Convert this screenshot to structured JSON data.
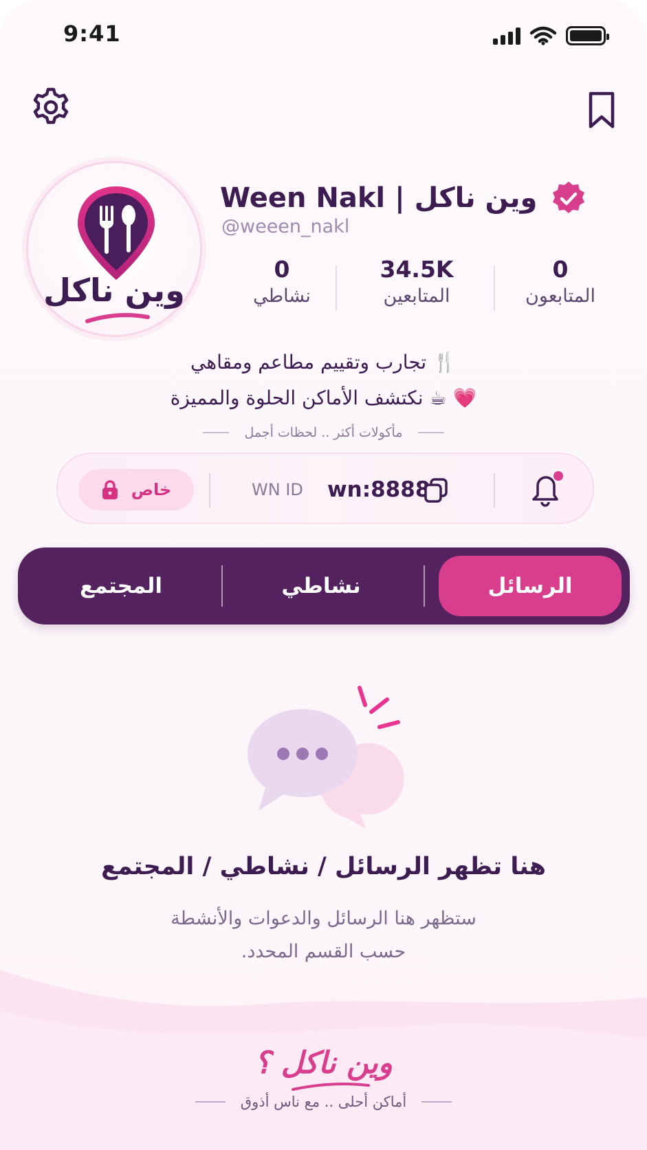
{
  "status_bar": {
    "time": "9:41"
  },
  "profile": {
    "logo_text": "وين ناكل",
    "name": "Ween Nakl | وين ناكل",
    "handle": "@weeen_nakl",
    "stats": [
      {
        "value": "0",
        "label": "نشاطي"
      },
      {
        "value": "34.5K",
        "label": "المتابعين"
      },
      {
        "value": "0",
        "label": "المتابعون"
      }
    ],
    "bio_line1": "🍴 تجارب وتقييم مطاعم ومقاهي",
    "bio_line2": "💗 ☕ نكتشف الأماكن الحلوة والمميزة",
    "tagline": "مأكولات أكثر .. لحظات أجمل"
  },
  "id_card": {
    "privacy_label": "خاص",
    "id_label": "WN ID",
    "id_value": "wn:8888"
  },
  "tabs": [
    {
      "label": "الرسائل",
      "active": true
    },
    {
      "label": "نشاطي",
      "active": false
    },
    {
      "label": "المجتمع",
      "active": false
    }
  ],
  "empty_state": {
    "title": "هنا تظهر الرسائل / نشاطي / المجتمع",
    "desc_line1": "ستظهر هنا الرسائل والدعوات والأنشطة",
    "desc_line2": "حسب القسم المحدد."
  },
  "footer": {
    "logo": "وين ناكل ؟",
    "tagline": "أماكن أحلى .. مع ناس أذوق"
  },
  "colors": {
    "primary_purple": "#54235f",
    "accent_pink": "#d93d8e",
    "text_dark": "#3d1c52"
  },
  "icons": [
    "gear-icon",
    "bookmark-icon",
    "verified-badge-icon",
    "lock-icon",
    "copy-icon",
    "bell-icon",
    "chat-bubbles-icon"
  ]
}
